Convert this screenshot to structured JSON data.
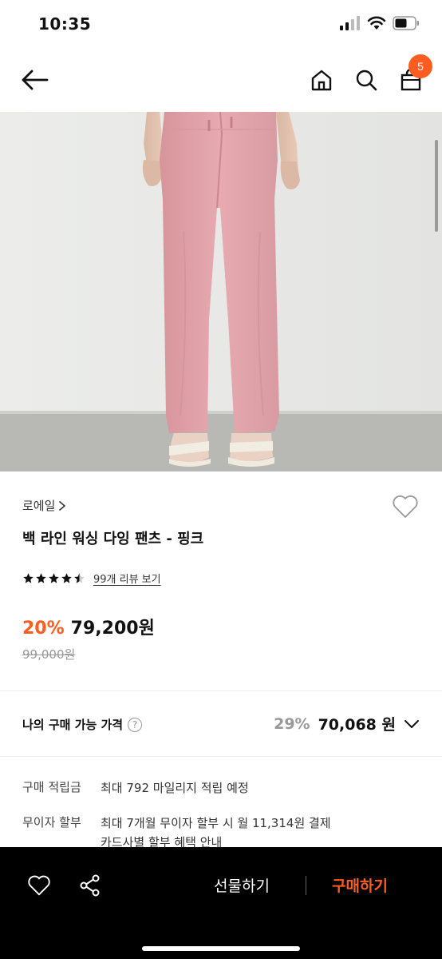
{
  "status_bar": {
    "time": "10:35"
  },
  "nav": {
    "cart_count": "5"
  },
  "product": {
    "brand": "로에일",
    "name": "백 라인 워싱 다잉 팬츠 - 핑크",
    "review_link": "99개 리뷰 보기",
    "rating": 4.5,
    "discount": "20%",
    "sale_price": "79,200원",
    "original_price": "99,000원"
  },
  "my_price": {
    "label": "나의 구매 가능 가격",
    "discount": "29%",
    "price": "70,068 원"
  },
  "info": [
    {
      "label": "구매 적립금",
      "value": "최대 792 마일리지 적립 예정"
    },
    {
      "label": "무이자 할부",
      "value": "최대 7개월 무이자 할부 시 월 11,314원 결제",
      "sub": "카드사별 할부 혜택 안내"
    }
  ],
  "bottom_bar": {
    "gift_label": "선물하기",
    "buy_label": "구매하기"
  },
  "colors": {
    "accent": "#ff5c1f",
    "pants": "#e0a2a8",
    "bottom_bar": "#000000"
  }
}
